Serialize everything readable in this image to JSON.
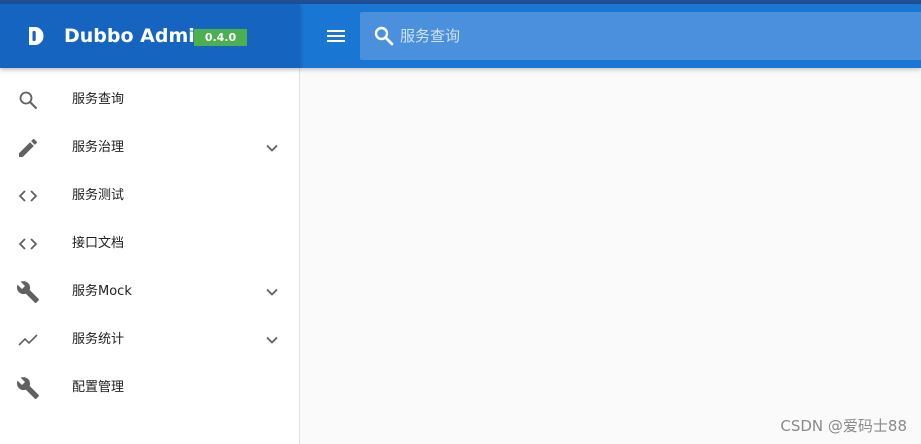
{
  "brand": {
    "title": "Dubbo Admin",
    "version": "0.4.0",
    "logo_icon": "dubbo-logo-icon"
  },
  "header": {
    "menu_icon": "hamburger-menu-icon",
    "search": {
      "icon": "search-icon",
      "placeholder": "服务查询",
      "value": ""
    }
  },
  "sidebar": {
    "items": [
      {
        "label": "服务查询",
        "icon": "search-icon",
        "expandable": false
      },
      {
        "label": "服务治理",
        "icon": "pencil-icon",
        "expandable": true
      },
      {
        "label": "服务测试",
        "icon": "code-icon",
        "expandable": false
      },
      {
        "label": "接口文档",
        "icon": "code-icon",
        "expandable": false
      },
      {
        "label": "服务Mock",
        "icon": "wrench-icon",
        "expandable": true
      },
      {
        "label": "服务统计",
        "icon": "trending-icon",
        "expandable": true
      },
      {
        "label": "配置管理",
        "icon": "wrench-icon",
        "expandable": false
      }
    ]
  },
  "watermark": "CSDN @爱码士88",
  "colors": {
    "brand_bg": "#1565c0",
    "header_bg": "#1976d2",
    "search_bg": "#4a90dc",
    "version_badge": "#4caf50",
    "top_strip": "#1e4f97"
  }
}
